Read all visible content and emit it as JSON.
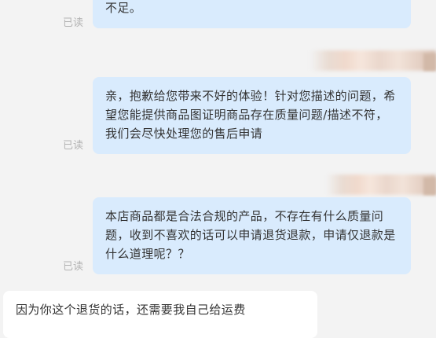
{
  "messages": [
    {
      "text": "不足。",
      "status": "已读"
    },
    {
      "text": "亲，抱歉给您带来不好的体验！针对您描述的问题，希望您能提供商品图证明商品存在质量问题/描述不符，我们会尽快处理您的售后申请",
      "status": "已读"
    },
    {
      "text": "本店商品都是合法合规的产品，不存在有什么质量问题，收到不喜欢的话可以申请退货退款，申请仅退款是什么道理呢？？",
      "status": "已读"
    }
  ],
  "incoming": {
    "text": "因为你这个退货的话，还需要我自己给运费"
  }
}
